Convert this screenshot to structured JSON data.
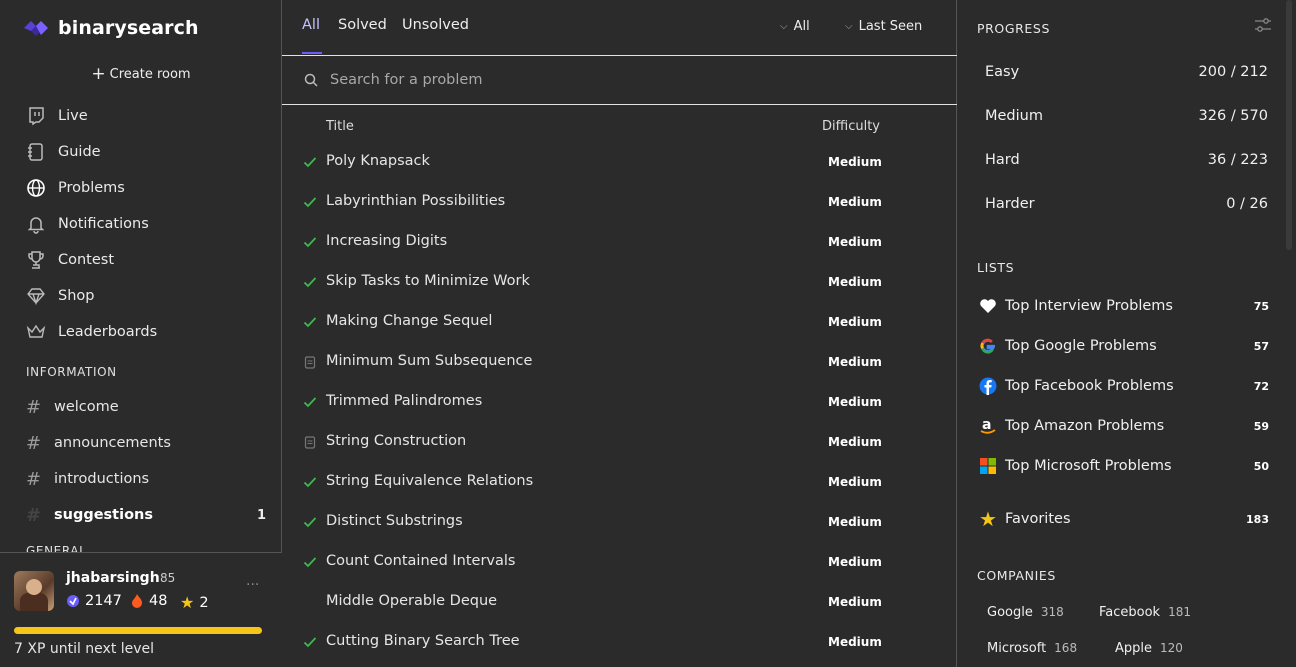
{
  "brand": {
    "name": "binarysearch"
  },
  "sidebar": {
    "create_room": "Create room",
    "nav": [
      {
        "label": "Live",
        "icon": "twitch-icon"
      },
      {
        "label": "Guide",
        "icon": "notebook-icon"
      },
      {
        "label": "Problems",
        "icon": "globe-icon"
      },
      {
        "label": "Notifications",
        "icon": "bell-icon"
      },
      {
        "label": "Contest",
        "icon": "trophy-icon"
      },
      {
        "label": "Shop",
        "icon": "diamond-icon"
      },
      {
        "label": "Leaderboards",
        "icon": "crown-icon"
      }
    ],
    "information_heading": "INFORMATION",
    "channels": [
      {
        "label": "welcome",
        "badge": ""
      },
      {
        "label": "announcements",
        "badge": ""
      },
      {
        "label": "introductions",
        "badge": ""
      },
      {
        "label": "suggestions",
        "badge": "1"
      }
    ],
    "general_heading": "GENERAL"
  },
  "user": {
    "name": "jhabarsingh",
    "level": "85",
    "rating": "2147",
    "streak": "48",
    "stars": "2",
    "xp_text": "7 XP until next level",
    "xp_fraction": 1.0
  },
  "filters": {
    "tabs": [
      "All",
      "Solved",
      "Unsolved"
    ],
    "active_tab": "All",
    "difficulty_filter": "All",
    "sort": "Last Seen",
    "search_placeholder": "Search for a problem"
  },
  "table": {
    "columns": {
      "title": "Title",
      "difficulty": "Difficulty"
    },
    "rows": [
      {
        "title": "Poly Knapsack",
        "difficulty": "Medium",
        "status": "solved"
      },
      {
        "title": "Labyrinthian Possibilities",
        "difficulty": "Medium",
        "status": "solved"
      },
      {
        "title": "Increasing Digits",
        "difficulty": "Medium",
        "status": "solved"
      },
      {
        "title": "Skip Tasks to Minimize Work",
        "difficulty": "Medium",
        "status": "solved"
      },
      {
        "title": "Making Change Sequel",
        "difficulty": "Medium",
        "status": "solved"
      },
      {
        "title": "Minimum Sum Subsequence",
        "difficulty": "Medium",
        "status": "attempted"
      },
      {
        "title": "Trimmed Palindromes",
        "difficulty": "Medium",
        "status": "solved"
      },
      {
        "title": "String Construction",
        "difficulty": "Medium",
        "status": "attempted"
      },
      {
        "title": "String Equivalence Relations",
        "difficulty": "Medium",
        "status": "solved"
      },
      {
        "title": "Distinct Substrings",
        "difficulty": "Medium",
        "status": "solved"
      },
      {
        "title": "Count Contained Intervals",
        "difficulty": "Medium",
        "status": "solved"
      },
      {
        "title": "Middle Operable Deque",
        "difficulty": "Medium",
        "status": "none"
      },
      {
        "title": "Cutting Binary Search Tree",
        "difficulty": "Medium",
        "status": "solved"
      }
    ]
  },
  "progress": {
    "heading": "PROGRESS",
    "rows": [
      {
        "label": "Easy",
        "value": "200 / 212"
      },
      {
        "label": "Medium",
        "value": "326 / 570"
      },
      {
        "label": "Hard",
        "value": "36 / 223"
      },
      {
        "label": "Harder",
        "value": "0 / 26"
      }
    ]
  },
  "lists": {
    "heading": "LISTS",
    "items": [
      {
        "label": "Top Interview Problems",
        "count": "75",
        "icon": "heart-icon"
      },
      {
        "label": "Top Google Problems",
        "count": "57",
        "icon": "google-icon"
      },
      {
        "label": "Top Facebook Problems",
        "count": "72",
        "icon": "facebook-icon"
      },
      {
        "label": "Top Amazon Problems",
        "count": "59",
        "icon": "amazon-icon"
      },
      {
        "label": "Top Microsoft Problems",
        "count": "50",
        "icon": "microsoft-icon"
      }
    ],
    "favorites": {
      "label": "Favorites",
      "count": "183",
      "icon": "star-icon"
    }
  },
  "companies": {
    "heading": "COMPANIES",
    "items": [
      {
        "name": "Google",
        "count": "318"
      },
      {
        "name": "Facebook",
        "count": "181"
      },
      {
        "name": "Microsoft",
        "count": "168"
      },
      {
        "name": "Apple",
        "count": "120"
      }
    ]
  },
  "colors": {
    "accent": "#6b5cff",
    "check": "#3fb950",
    "xp_bar": "#f5c518",
    "bg": "#2b2b2b"
  }
}
